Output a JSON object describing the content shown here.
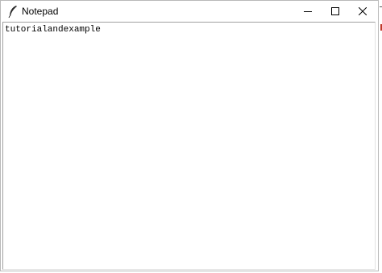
{
  "window": {
    "title": "Notepad",
    "app_icon": "feather-icon",
    "controls": {
      "minimize_icon": "minimize-icon",
      "maximize_icon": "maximize-icon",
      "close_icon": "close-icon"
    }
  },
  "editor": {
    "content": "tutorialandexample"
  },
  "colors": {
    "titlebar_bg": "#ffffff",
    "text": "#000000",
    "editor_bg": "#ffffff"
  }
}
